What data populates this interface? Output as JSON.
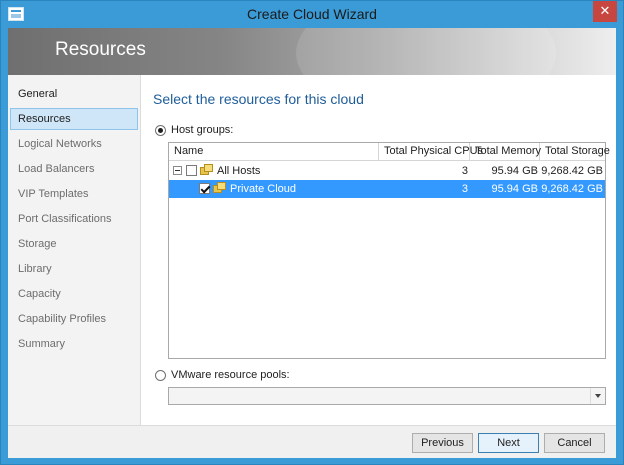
{
  "window": {
    "title": "Create Cloud Wizard",
    "close_glyph": "✕"
  },
  "banner": {
    "title": "Resources"
  },
  "nav": {
    "items": [
      {
        "label": "General"
      },
      {
        "label": "Resources"
      },
      {
        "label": "Logical Networks"
      },
      {
        "label": "Load Balancers"
      },
      {
        "label": "VIP Templates"
      },
      {
        "label": "Port Classifications"
      },
      {
        "label": "Storage"
      },
      {
        "label": "Library"
      },
      {
        "label": "Capacity"
      },
      {
        "label": "Capability Profiles"
      },
      {
        "label": "Summary"
      }
    ],
    "active": "Resources"
  },
  "main": {
    "heading": "Select the resources for this cloud",
    "host_groups": {
      "label": "Host groups:",
      "selected": true,
      "columns": [
        "Name",
        "Total Physical CPUs",
        "Total Memory",
        "Total Storage"
      ],
      "rows": [
        {
          "name": "All Hosts",
          "cpus": "3",
          "memory": "95.94 GB",
          "storage": "9,268.42 GB",
          "checked": false,
          "expanded": true,
          "selected": false
        },
        {
          "name": "Private Cloud",
          "cpus": "3",
          "memory": "95.94 GB",
          "storage": "9,268.42 GB",
          "checked": true,
          "selected": true
        }
      ]
    },
    "vmware_pools": {
      "label": "VMware resource pools:",
      "selected": false,
      "value": ""
    }
  },
  "footer": {
    "previous_label": "Previous",
    "next_label": "Next",
    "cancel_label": "Cancel"
  },
  "colors": {
    "accent": "#3b9bd6",
    "selection": "#3399ff",
    "heading": "#1f5d9a",
    "close": "#c7463f"
  },
  "icons": {
    "app": "wizard-window-icon",
    "host_group": "host-group-icon",
    "close": "close-icon",
    "dropdown": "chevron-down-icon"
  }
}
